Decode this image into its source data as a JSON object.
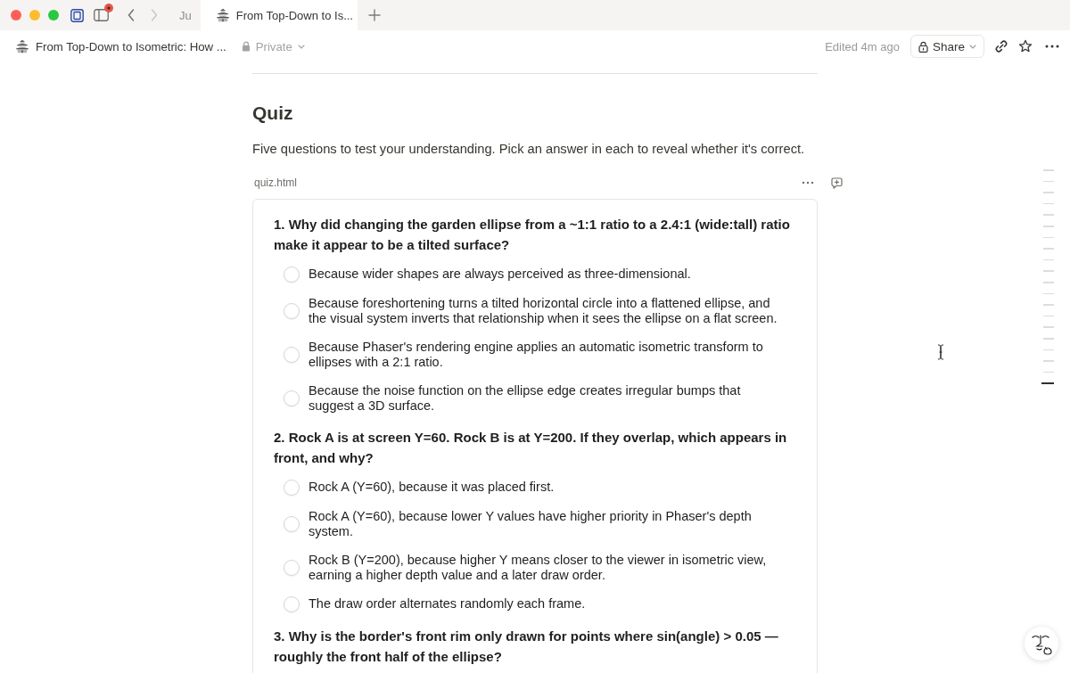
{
  "tab_bar": {
    "sidebar_toggle": {
      "badge": true
    },
    "navigation": [
      {
        "kind": "back",
        "disabled": false
      },
      {
        "kind": "forward",
        "disabled": true
      }
    ],
    "tabs": [
      {
        "kind": "truncated",
        "title": "Ju",
        "selected": false
      },
      {
        "kind": "page",
        "title": "From Top-Down to Is...",
        "selected": true
      }
    ]
  },
  "page_header": {
    "title": "From Top-Down to Isometric: How ...",
    "visibility": "Private",
    "edited": "Edited 4m ago",
    "share_button": "Share"
  },
  "page": {
    "heading": "Quiz",
    "intro": "Five questions to test your understanding. Pick an answer in each to reveal whether it's correct.",
    "embed": {
      "filename": "quiz.html",
      "questions": [
        {
          "text": "1. Why did changing the garden ellipse from a ~1:1 ratio to a 2.4:1 (wide:tall) ratio make it appear to be a tilted surface?",
          "options": [
            {
              "text": "Because wider shapes are always perceived as three-dimensional.",
              "selected": false
            },
            {
              "text": "Because foreshortening turns a tilted horizontal circle into a flattened ellipse, and the visual system inverts that relationship when it sees the ellipse on a flat screen.",
              "selected": false
            },
            {
              "text": "Because Phaser's rendering engine applies an automatic isometric transform to ellipses with a 2:1 ratio.",
              "selected": false
            },
            {
              "text": "Because the noise function on the ellipse edge creates irregular bumps that suggest a 3D surface.",
              "selected": false
            }
          ]
        },
        {
          "text": "2. Rock A is at screen Y=60. Rock B is at Y=200. If they overlap, which appears in front, and why?",
          "options": [
            {
              "text": "Rock A (Y=60), because it was placed first.",
              "selected": false
            },
            {
              "text": "Rock A (Y=60), because lower Y values have higher priority in Phaser's depth system.",
              "selected": false
            },
            {
              "text": "Rock B (Y=200), because higher Y means closer to the viewer in isometric view, earning a higher depth value and a later draw order.",
              "selected": false
            },
            {
              "text": "The draw order alternates randomly each frame.",
              "selected": false
            }
          ]
        },
        {
          "text": "3. Why is the border's front rim only drawn for points where sin(angle) > 0.05 — roughly the front half of the ellipse?"
        }
      ]
    }
  },
  "outline": [
    {
      "selected": false
    },
    {
      "selected": false
    },
    {
      "selected": false
    },
    {
      "selected": false
    },
    {
      "selected": false
    },
    {
      "selected": false
    },
    {
      "selected": false
    },
    {
      "selected": false
    },
    {
      "selected": false
    },
    {
      "selected": false
    },
    {
      "selected": false
    },
    {
      "selected": false
    },
    {
      "selected": false
    },
    {
      "selected": false
    },
    {
      "selected": false
    },
    {
      "selected": false
    },
    {
      "selected": false
    },
    {
      "selected": false
    },
    {
      "selected": false
    },
    {
      "selected": true
    }
  ]
}
